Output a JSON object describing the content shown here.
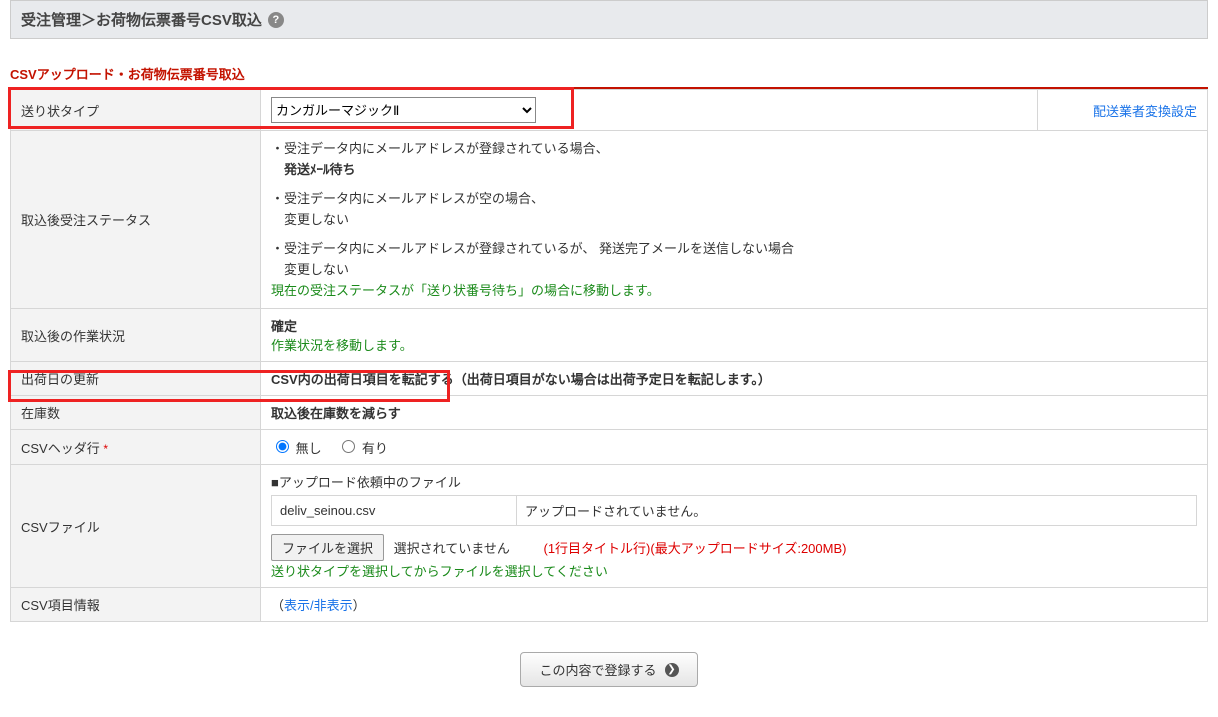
{
  "breadcrumb": {
    "text": "受注管理＞お荷物伝票番号CSV取込"
  },
  "section_title": "CSVアップロード・お荷物伝票番号取込",
  "rows": {
    "invoice_type": {
      "label": "送り状タイプ",
      "selected": "カンガルーマジックⅡ",
      "right_link": "配送業者変換設定"
    },
    "status_after": {
      "label": "取込後受注ステータス",
      "line1a": "・受注データ内にメールアドレスが登録されている場合、",
      "line1b": "発送ﾒｰﾙ待ち",
      "line2a": "・受注データ内にメールアドレスが空の場合、",
      "line2b": "変更しない",
      "line3a": "・受注データ内にメールアドレスが登録されているが、 発送完了メールを送信しない場合",
      "line3b": "変更しない",
      "green": "現在の受注ステータスが「送り状番号待ち」の場合に移動します。"
    },
    "work_status": {
      "label": "取込後の作業状況",
      "value": "確定",
      "green": "作業状況を移動します。"
    },
    "ship_date": {
      "label": "出荷日の更新",
      "value": "CSV内の出荷日項目を転記する（出荷日項目がない場合は出荷予定日を転記します。）"
    },
    "stock": {
      "label": "在庫数",
      "value": "取込後在庫数を減らす"
    },
    "header_row": {
      "label": "CSVヘッダ行",
      "req": "*",
      "opt_none": "無し",
      "opt_exist": "有り"
    },
    "csv_file": {
      "label": "CSVファイル",
      "upload_heading": "■アップロード依頼中のファイル",
      "filename": "deliv_seinou.csv",
      "upload_state": "アップロードされていません。",
      "choose_btn": "ファイルを選択",
      "choose_status": "選択されていません",
      "note": "(1行目タイトル行)(最大アップロードサイズ:200MB)",
      "green": "送り状タイプを選択してからファイルを選択してください"
    },
    "csv_columns": {
      "label": "CSV項目情報",
      "paren_open": "（",
      "link": "表示/非表示",
      "paren_close": "）"
    }
  },
  "submit_label": "この内容で登録する"
}
